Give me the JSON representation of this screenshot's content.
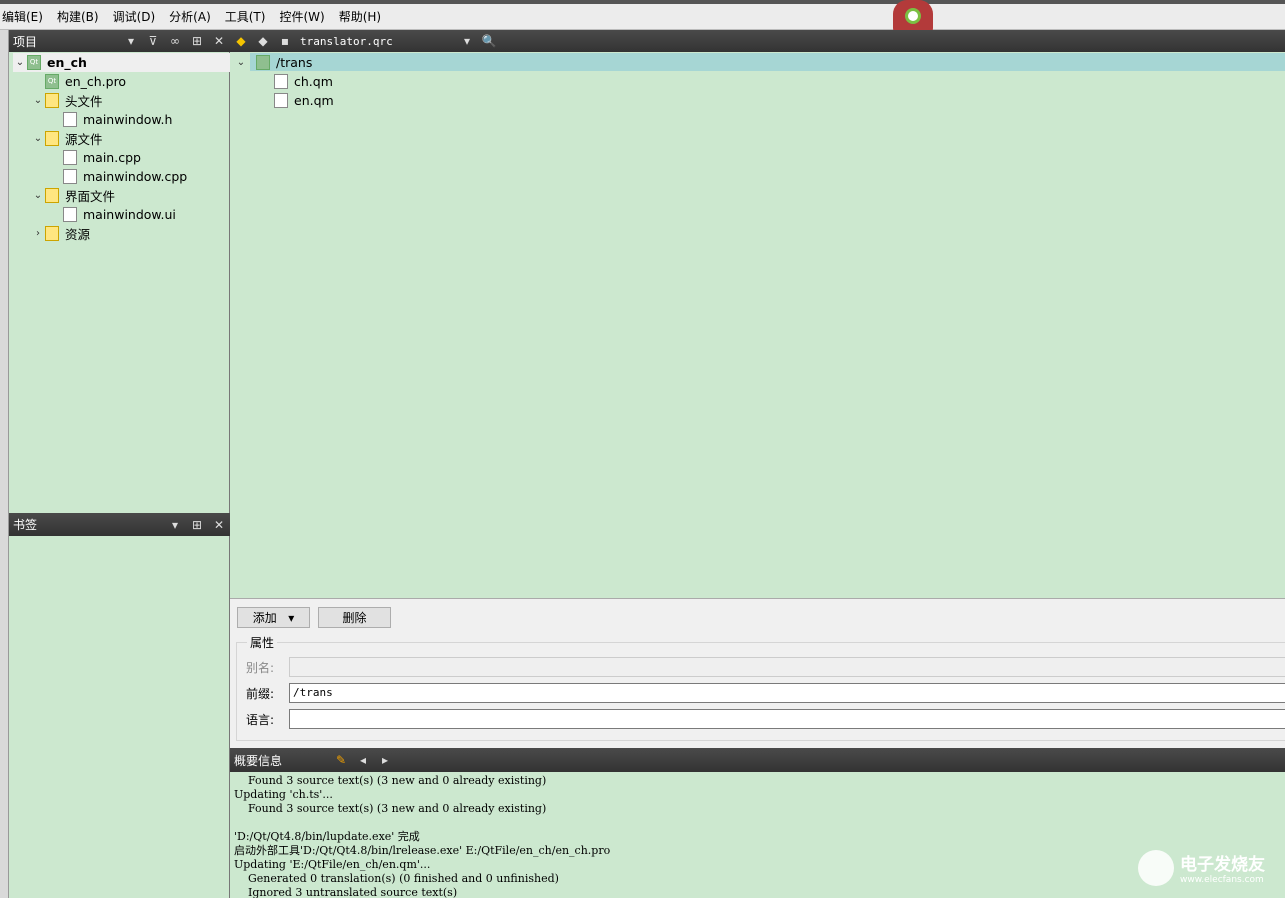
{
  "menu": [
    "编辑(E)",
    "构建(B)",
    "调试(D)",
    "分析(A)",
    "工具(T)",
    "控件(W)",
    "帮助(H)"
  ],
  "project_panel": {
    "title": "项目",
    "tree": [
      {
        "label": "en_ch",
        "level": 0,
        "expanded": true,
        "icon": "qt-project-icon",
        "bold": true
      },
      {
        "label": "en_ch.pro",
        "level": 1,
        "icon": "qt-pro-icon"
      },
      {
        "label": "头文件",
        "level": 1,
        "expanded": true,
        "icon": "header-folder-icon"
      },
      {
        "label": "mainwindow.h",
        "level": 2,
        "icon": "header-file-icon"
      },
      {
        "label": "源文件",
        "level": 1,
        "expanded": true,
        "icon": "source-folder-icon"
      },
      {
        "label": "main.cpp",
        "level": 2,
        "icon": "cpp-file-icon"
      },
      {
        "label": "mainwindow.cpp",
        "level": 2,
        "icon": "cpp-file-icon"
      },
      {
        "label": "界面文件",
        "level": 1,
        "expanded": true,
        "icon": "form-folder-icon"
      },
      {
        "label": "mainwindow.ui",
        "level": 2,
        "icon": "ui-file-icon"
      },
      {
        "label": "资源",
        "level": 1,
        "expanded": false,
        "icon": "resource-folder-icon"
      }
    ]
  },
  "bookmark_panel": {
    "title": "书签"
  },
  "editor": {
    "file": "translator.qrc",
    "tree": [
      {
        "label": "/trans",
        "level": 0
      },
      {
        "label": "ch.qm",
        "level": 1
      },
      {
        "label": "en.qm",
        "level": 1
      }
    ]
  },
  "props": {
    "add": "添加",
    "remove": "删除",
    "group": "属性",
    "alias_label": "别名:",
    "alias_value": "",
    "prefix_label": "前缀:",
    "prefix_value": "/trans",
    "lang_label": "语言:",
    "lang_value": ""
  },
  "output": {
    "title": "概要信息",
    "lines": [
      "    Found 3 source text(s) (3 new and 0 already existing)",
      "Updating 'ch.ts'...",
      "    Found 3 source text(s) (3 new and 0 already existing)",
      "",
      "'D:/Qt/Qt4.8/bin/lupdate.exe' 完成",
      "启动外部工具'D:/Qt/Qt4.8/bin/lrelease.exe' E:/QtFile/en_ch/en_ch.pro",
      "Updating 'E:/QtFile/en_ch/en.qm'...",
      "    Generated 0 translation(s) (0 finished and 0 unfinished)",
      "    Ignored 3 untranslated source text(s)"
    ]
  },
  "watermark": {
    "name": "电子发烧友",
    "url": "www.elecfans.com"
  }
}
